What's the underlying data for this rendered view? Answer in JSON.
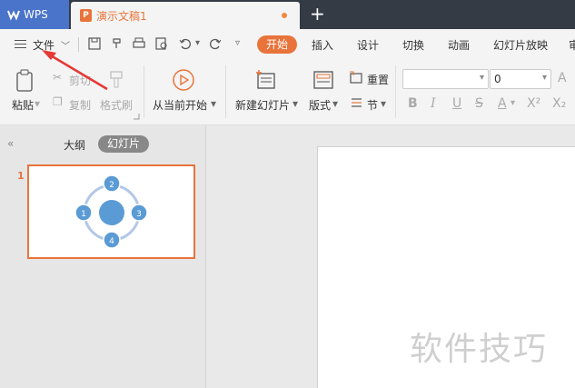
{
  "titlebar": {
    "app_name": "WPS",
    "doc_tab": "演示文稿1",
    "doc_icon_letter": "P",
    "new_tab_label": "+"
  },
  "menubar": {
    "file_label": "文件",
    "tabs": [
      "开始",
      "插入",
      "设计",
      "切换",
      "动画",
      "幻灯片放映",
      "审"
    ]
  },
  "ribbon": {
    "paste": "粘贴",
    "cut": "剪切",
    "copy": "复制",
    "format_painter": "格式刷",
    "play_from_current": "从当前开始",
    "new_slide": "新建幻灯片",
    "layout": "版式",
    "reset": "重置",
    "section": "节",
    "font_name": "",
    "font_size": "0"
  },
  "leftpanel": {
    "outline_tab": "大纲",
    "slides_tab": "幻灯片",
    "slide_number": "1",
    "diagram_nodes": [
      "1",
      "2",
      "3",
      "4"
    ]
  },
  "watermark": "软件技巧",
  "colors": {
    "accent": "#e8743b",
    "titlebar": "#353b45",
    "wps_blue": "#4a74c9",
    "node_blue": "#5b9bd5",
    "arrow_red": "#e53935"
  }
}
